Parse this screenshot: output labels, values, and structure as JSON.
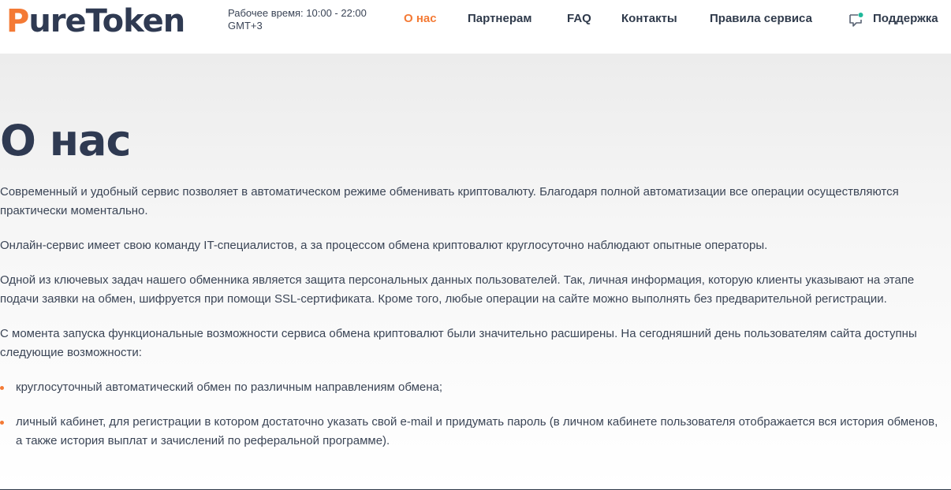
{
  "header": {
    "logo": {
      "first_letter": "P",
      "rest": "ureToken"
    },
    "hours": "Рабочее время: 10:00 - 22:00 GMT+3",
    "nav": [
      {
        "label": "О нас",
        "active": true
      },
      {
        "label": "Партнерам",
        "active": false
      },
      {
        "label": "FAQ",
        "active": false
      },
      {
        "label": "Контакты",
        "active": false
      },
      {
        "label": "Правила сервиса",
        "active": false
      }
    ],
    "support": {
      "label": "Поддержка",
      "icon": "chat-bubble-icon"
    }
  },
  "main": {
    "title": "О нас",
    "paragraphs": [
      "Современный и удобный сервис позволяет в автоматическом режиме обменивать криптовалюту. Благодаря полной автоматизации все операции осуществляются практически моментально.",
      "Онлайн-сервис имеет свою команду IT-специалистов, а за процессом обмена криптовалют круглосуточно наблюдают опытные операторы.",
      "Одной из ключевых задач нашего обменника является защита персональных данных пользователей. Так, личная информация, которую клиенты указывают на этапе подачи заявки на обмен, шифруется при помощи SSL-сертификата. Кроме того, любые операции на сайте можно выполнять без предварительной регистрации.",
      "С момента запуска функциональные возможности сервиса обмена криптовалют были значительно расширены. На сегодняшний день пользователям сайта доступны следующие возможности:"
    ],
    "features": [
      "круглосуточный автоматический обмен по различным направлениям обмена;",
      "личный кабинет, для регистрации в котором достаточно указать свой e-mail и придумать пароль (в личном кабинете пользователя отображается вся история обменов, а также история выплат и зачислений по реферальной программе)."
    ]
  },
  "colors": {
    "accent": "#f47a35",
    "text_dark": "#2f3a52",
    "support_dot": "#1fb89a"
  }
}
